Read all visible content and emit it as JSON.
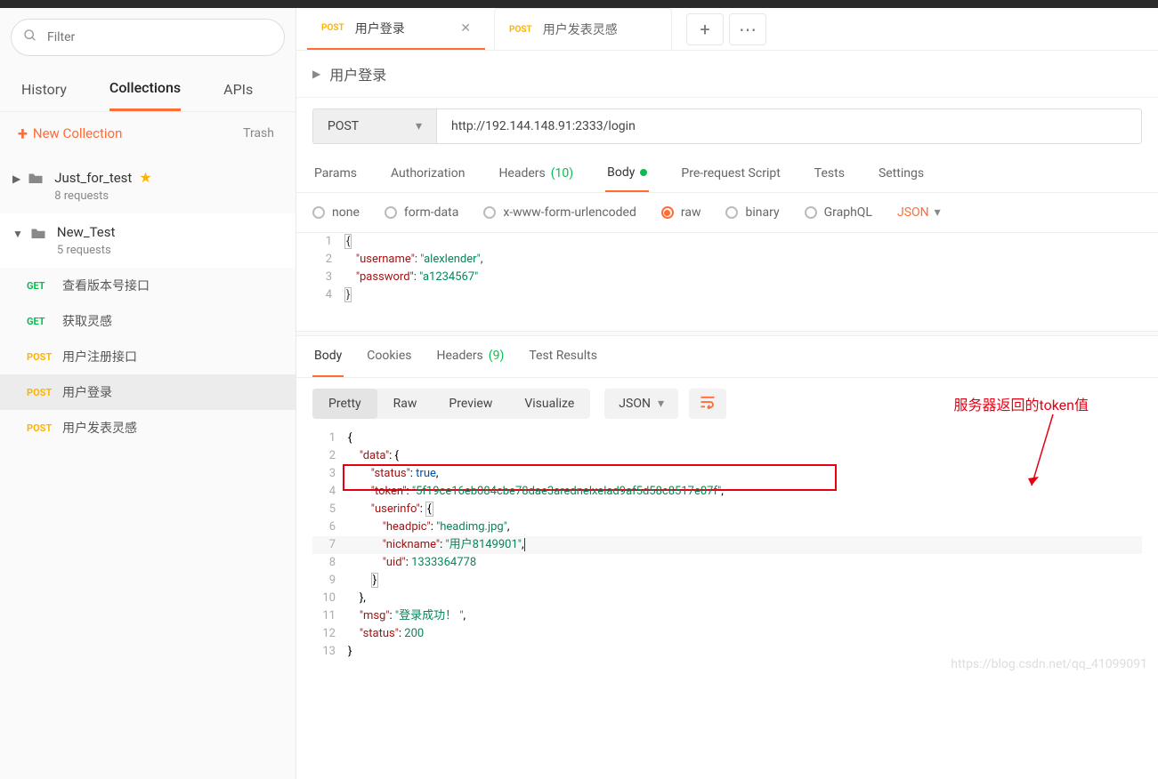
{
  "sidebar": {
    "filter_placeholder": "Filter",
    "tabs": {
      "history": "History",
      "collections": "Collections",
      "apis": "APIs"
    },
    "new_collection": "New Collection",
    "trash": "Trash",
    "collections": [
      {
        "name": "Just_for_test",
        "sub": "8 requests",
        "starred": true,
        "expanded": false
      },
      {
        "name": "New_Test",
        "sub": "5 requests",
        "starred": false,
        "expanded": true
      }
    ],
    "requests": [
      {
        "method": "GET",
        "name": "查看版本号接口"
      },
      {
        "method": "GET",
        "name": "获取灵感"
      },
      {
        "method": "POST",
        "name": "用户注册接口"
      },
      {
        "method": "POST",
        "name": "用户登录",
        "active": true
      },
      {
        "method": "POST",
        "name": "用户发表灵感"
      }
    ]
  },
  "tabs": [
    {
      "method": "POST",
      "name": "用户登录",
      "active": true
    },
    {
      "method": "POST",
      "name": "用户发表灵感",
      "active": false
    }
  ],
  "breadcrumb": "用户登录",
  "request": {
    "method": "POST",
    "url": "http://192.144.148.91:2333/login",
    "req_tabs": {
      "params": "Params",
      "auth": "Authorization",
      "headers": "Headers",
      "headers_count": "(10)",
      "body": "Body",
      "prereq": "Pre-request Script",
      "tests": "Tests",
      "settings": "Settings"
    },
    "body_types": {
      "none": "none",
      "formdata": "form-data",
      "xwww": "x-www-form-urlencoded",
      "raw": "raw",
      "binary": "binary",
      "graphql": "GraphQL"
    },
    "raw_type": "JSON",
    "body_json": {
      "username": "alexlender",
      "password": "a1234567"
    }
  },
  "response": {
    "tabs": {
      "body": "Body",
      "cookies": "Cookies",
      "headers": "Headers",
      "headers_count": "(9)",
      "tests": "Test Results"
    },
    "views": {
      "pretty": "Pretty",
      "raw": "Raw",
      "preview": "Preview",
      "visualize": "Visualize"
    },
    "format": "JSON",
    "annotation": "服务器返回的token值",
    "json": {
      "data": {
        "status": true,
        "token": "5f19ce16eb084cbe78dae3arednelxelad9af5d58c8517e07f",
        "userinfo": {
          "headpic": "headimg.jpg",
          "nickname": "用户8149901",
          "uid": 1333364778
        }
      },
      "msg": "登录成功！ ",
      "status": 200
    }
  },
  "watermark": "https://blog.csdn.net/qq_41099091"
}
